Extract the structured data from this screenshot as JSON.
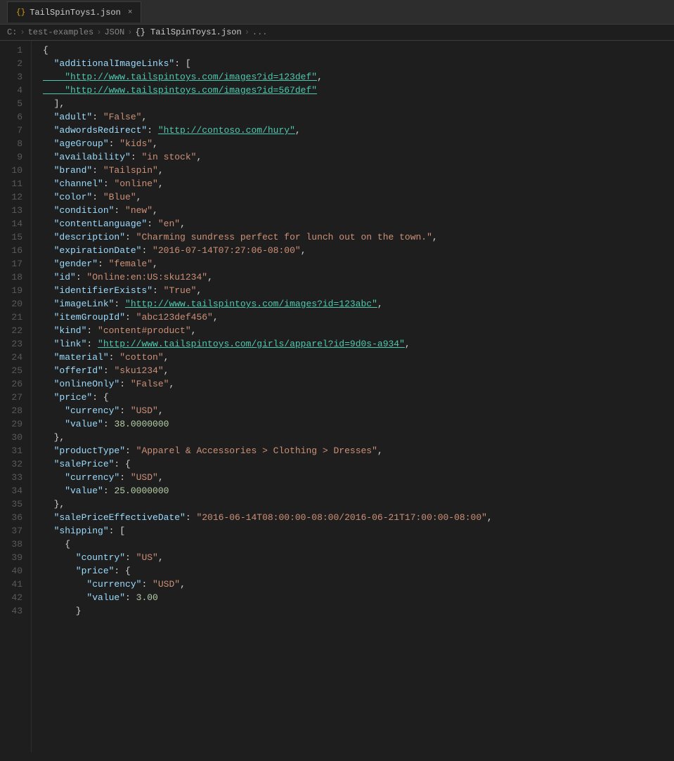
{
  "tab": {
    "icon": "{}",
    "label": "TailSpinToys1.json",
    "close": "×"
  },
  "breadcrumb": {
    "items": [
      "C:",
      "test-examples",
      "JSON",
      "{} TailSpinToys1.json",
      "..."
    ]
  },
  "lines": [
    {
      "num": 1,
      "content": [
        {
          "t": "p",
          "v": "{"
        }
      ]
    },
    {
      "num": 2,
      "content": [
        {
          "t": "k",
          "v": "  \"additionalImageLinks\""
        },
        {
          "t": "p",
          "v": ": ["
        }
      ]
    },
    {
      "num": 3,
      "content": [
        {
          "t": "u",
          "v": "    \"http://www.tailspintoys.com/images?id=123def\""
        },
        {
          "t": "p",
          "v": ","
        }
      ]
    },
    {
      "num": 4,
      "content": [
        {
          "t": "u",
          "v": "    \"http://www.tailspintoys.com/images?id=567def\""
        }
      ]
    },
    {
      "num": 5,
      "content": [
        {
          "t": "p",
          "v": "  ],"
        }
      ]
    },
    {
      "num": 6,
      "content": [
        {
          "t": "k",
          "v": "  \"adult\""
        },
        {
          "t": "p",
          "v": ": "
        },
        {
          "t": "s",
          "v": "\"False\""
        },
        {
          "t": "p",
          "v": ","
        }
      ]
    },
    {
      "num": 7,
      "content": [
        {
          "t": "k",
          "v": "  \"adwordsRedirect\""
        },
        {
          "t": "p",
          "v": ": "
        },
        {
          "t": "u",
          "v": "\"http://contoso.com/hury\""
        },
        {
          "t": "p",
          "v": ","
        }
      ]
    },
    {
      "num": 8,
      "content": [
        {
          "t": "k",
          "v": "  \"ageGroup\""
        },
        {
          "t": "p",
          "v": ": "
        },
        {
          "t": "s",
          "v": "\"kids\""
        },
        {
          "t": "p",
          "v": ","
        }
      ]
    },
    {
      "num": 9,
      "content": [
        {
          "t": "k",
          "v": "  \"availability\""
        },
        {
          "t": "p",
          "v": ": "
        },
        {
          "t": "s",
          "v": "\"in stock\""
        },
        {
          "t": "p",
          "v": ","
        }
      ]
    },
    {
      "num": 10,
      "content": [
        {
          "t": "k",
          "v": "  \"brand\""
        },
        {
          "t": "p",
          "v": ": "
        },
        {
          "t": "s",
          "v": "\"Tailspin\""
        },
        {
          "t": "p",
          "v": ","
        }
      ]
    },
    {
      "num": 11,
      "content": [
        {
          "t": "k",
          "v": "  \"channel\""
        },
        {
          "t": "p",
          "v": ": "
        },
        {
          "t": "s",
          "v": "\"online\""
        },
        {
          "t": "p",
          "v": ","
        }
      ]
    },
    {
      "num": 12,
      "content": [
        {
          "t": "k",
          "v": "  \"color\""
        },
        {
          "t": "p",
          "v": ": "
        },
        {
          "t": "s",
          "v": "\"Blue\""
        },
        {
          "t": "p",
          "v": ","
        }
      ]
    },
    {
      "num": 13,
      "content": [
        {
          "t": "k",
          "v": "  \"condition\""
        },
        {
          "t": "p",
          "v": ": "
        },
        {
          "t": "s",
          "v": "\"new\""
        },
        {
          "t": "p",
          "v": ","
        }
      ]
    },
    {
      "num": 14,
      "content": [
        {
          "t": "k",
          "v": "  \"contentLanguage\""
        },
        {
          "t": "p",
          "v": ": "
        },
        {
          "t": "s",
          "v": "\"en\""
        },
        {
          "t": "p",
          "v": ","
        }
      ]
    },
    {
      "num": 15,
      "content": [
        {
          "t": "k",
          "v": "  \"description\""
        },
        {
          "t": "p",
          "v": ": "
        },
        {
          "t": "s",
          "v": "\"Charming sundress perfect for lunch out on the town.\""
        },
        {
          "t": "p",
          "v": ","
        }
      ]
    },
    {
      "num": 16,
      "content": [
        {
          "t": "k",
          "v": "  \"expirationDate\""
        },
        {
          "t": "p",
          "v": ": "
        },
        {
          "t": "s",
          "v": "\"2016-07-14T07:27:06-08:00\""
        },
        {
          "t": "p",
          "v": ","
        }
      ]
    },
    {
      "num": 17,
      "content": [
        {
          "t": "k",
          "v": "  \"gender\""
        },
        {
          "t": "p",
          "v": ": "
        },
        {
          "t": "s",
          "v": "\"female\""
        },
        {
          "t": "p",
          "v": ","
        }
      ]
    },
    {
      "num": 18,
      "content": [
        {
          "t": "k",
          "v": "  \"id\""
        },
        {
          "t": "p",
          "v": ": "
        },
        {
          "t": "s",
          "v": "\"Online:en:US:sku1234\""
        },
        {
          "t": "p",
          "v": ","
        }
      ]
    },
    {
      "num": 19,
      "content": [
        {
          "t": "k",
          "v": "  \"identifierExists\""
        },
        {
          "t": "p",
          "v": ": "
        },
        {
          "t": "s",
          "v": "\"True\""
        },
        {
          "t": "p",
          "v": ","
        }
      ]
    },
    {
      "num": 20,
      "content": [
        {
          "t": "k",
          "v": "  \"imageLink\""
        },
        {
          "t": "p",
          "v": ": "
        },
        {
          "t": "u",
          "v": "\"http://www.tailspintoys.com/images?id=123abc\""
        },
        {
          "t": "p",
          "v": ","
        }
      ]
    },
    {
      "num": 21,
      "content": [
        {
          "t": "k",
          "v": "  \"itemGroupId\""
        },
        {
          "t": "p",
          "v": ": "
        },
        {
          "t": "s",
          "v": "\"abc123def456\""
        },
        {
          "t": "p",
          "v": ","
        }
      ]
    },
    {
      "num": 22,
      "content": [
        {
          "t": "k",
          "v": "  \"kind\""
        },
        {
          "t": "p",
          "v": ": "
        },
        {
          "t": "s",
          "v": "\"content#product\""
        },
        {
          "t": "p",
          "v": ","
        }
      ]
    },
    {
      "num": 23,
      "content": [
        {
          "t": "k",
          "v": "  \"link\""
        },
        {
          "t": "p",
          "v": ": "
        },
        {
          "t": "u",
          "v": "\"http://www.tailspintoys.com/girls/apparel?id=9d0s-a934\""
        },
        {
          "t": "p",
          "v": ","
        }
      ]
    },
    {
      "num": 24,
      "content": [
        {
          "t": "k",
          "v": "  \"material\""
        },
        {
          "t": "p",
          "v": ": "
        },
        {
          "t": "s",
          "v": "\"cotton\""
        },
        {
          "t": "p",
          "v": ","
        }
      ]
    },
    {
      "num": 25,
      "content": [
        {
          "t": "k",
          "v": "  \"offerId\""
        },
        {
          "t": "p",
          "v": ": "
        },
        {
          "t": "s",
          "v": "\"sku1234\""
        },
        {
          "t": "p",
          "v": ","
        }
      ]
    },
    {
      "num": 26,
      "content": [
        {
          "t": "k",
          "v": "  \"onlineOnly\""
        },
        {
          "t": "p",
          "v": ": "
        },
        {
          "t": "s",
          "v": "\"False\""
        },
        {
          "t": "p",
          "v": ","
        }
      ]
    },
    {
      "num": 27,
      "content": [
        {
          "t": "k",
          "v": "  \"price\""
        },
        {
          "t": "p",
          "v": ": {"
        }
      ]
    },
    {
      "num": 28,
      "content": [
        {
          "t": "k",
          "v": "    \"currency\""
        },
        {
          "t": "p",
          "v": ": "
        },
        {
          "t": "s",
          "v": "\"USD\""
        },
        {
          "t": "p",
          "v": ","
        }
      ]
    },
    {
      "num": 29,
      "content": [
        {
          "t": "k",
          "v": "    \"value\""
        },
        {
          "t": "p",
          "v": ": "
        },
        {
          "t": "n",
          "v": "38.0000000"
        }
      ]
    },
    {
      "num": 30,
      "content": [
        {
          "t": "p",
          "v": "  },"
        }
      ]
    },
    {
      "num": 31,
      "content": [
        {
          "t": "k",
          "v": "  \"productType\""
        },
        {
          "t": "p",
          "v": ": "
        },
        {
          "t": "s",
          "v": "\"Apparel & Accessories > Clothing > Dresses\""
        },
        {
          "t": "p",
          "v": ","
        }
      ]
    },
    {
      "num": 32,
      "content": [
        {
          "t": "k",
          "v": "  \"salePrice\""
        },
        {
          "t": "p",
          "v": ": {"
        }
      ]
    },
    {
      "num": 33,
      "content": [
        {
          "t": "k",
          "v": "    \"currency\""
        },
        {
          "t": "p",
          "v": ": "
        },
        {
          "t": "s",
          "v": "\"USD\""
        },
        {
          "t": "p",
          "v": ","
        }
      ]
    },
    {
      "num": 34,
      "content": [
        {
          "t": "k",
          "v": "    \"value\""
        },
        {
          "t": "p",
          "v": ": "
        },
        {
          "t": "n",
          "v": "25.0000000"
        }
      ]
    },
    {
      "num": 35,
      "content": [
        {
          "t": "p",
          "v": "  },"
        }
      ]
    },
    {
      "num": 36,
      "content": [
        {
          "t": "k",
          "v": "  \"salePriceEffectiveDate\""
        },
        {
          "t": "p",
          "v": ": "
        },
        {
          "t": "s",
          "v": "\"2016-06-14T08:00:00-08:00/2016-06-21T17:00:00-08:00\""
        },
        {
          "t": "p",
          "v": ","
        }
      ]
    },
    {
      "num": 37,
      "content": [
        {
          "t": "k",
          "v": "  \"shipping\""
        },
        {
          "t": "p",
          "v": ": ["
        }
      ]
    },
    {
      "num": 38,
      "content": [
        {
          "t": "p",
          "v": "    {"
        }
      ]
    },
    {
      "num": 39,
      "content": [
        {
          "t": "k",
          "v": "      \"country\""
        },
        {
          "t": "p",
          "v": ": "
        },
        {
          "t": "s",
          "v": "\"US\""
        },
        {
          "t": "p",
          "v": ","
        }
      ]
    },
    {
      "num": 40,
      "content": [
        {
          "t": "k",
          "v": "      \"price\""
        },
        {
          "t": "p",
          "v": ": {"
        }
      ]
    },
    {
      "num": 41,
      "content": [
        {
          "t": "k",
          "v": "        \"currency\""
        },
        {
          "t": "p",
          "v": ": "
        },
        {
          "t": "s",
          "v": "\"USD\""
        },
        {
          "t": "p",
          "v": ","
        }
      ]
    },
    {
      "num": 42,
      "content": [
        {
          "t": "k",
          "v": "        \"value\""
        },
        {
          "t": "p",
          "v": ": "
        },
        {
          "t": "n",
          "v": "3.00"
        }
      ]
    },
    {
      "num": 43,
      "content": [
        {
          "t": "p",
          "v": "      }"
        }
      ]
    }
  ]
}
